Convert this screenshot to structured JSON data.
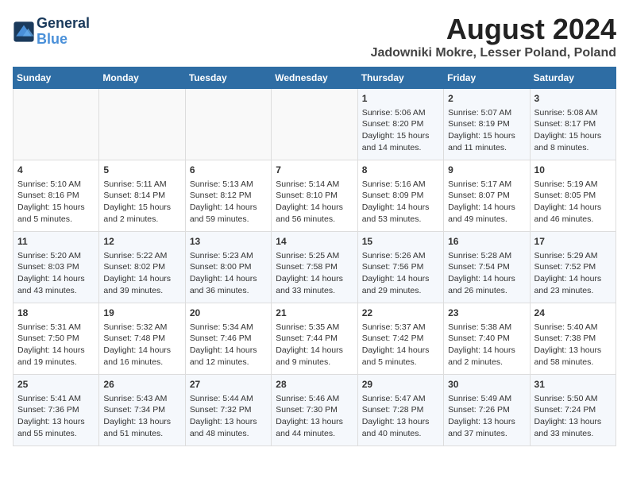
{
  "header": {
    "logo_line1": "General",
    "logo_line2": "Blue",
    "title": "August 2024",
    "subtitle": "Jadowniki Mokre, Lesser Poland, Poland"
  },
  "days_of_week": [
    "Sunday",
    "Monday",
    "Tuesday",
    "Wednesday",
    "Thursday",
    "Friday",
    "Saturday"
  ],
  "weeks": [
    [
      {
        "day": "",
        "content": ""
      },
      {
        "day": "",
        "content": ""
      },
      {
        "day": "",
        "content": ""
      },
      {
        "day": "",
        "content": ""
      },
      {
        "day": "1",
        "content": "Sunrise: 5:06 AM\nSunset: 8:20 PM\nDaylight: 15 hours\nand 14 minutes."
      },
      {
        "day": "2",
        "content": "Sunrise: 5:07 AM\nSunset: 8:19 PM\nDaylight: 15 hours\nand 11 minutes."
      },
      {
        "day": "3",
        "content": "Sunrise: 5:08 AM\nSunset: 8:17 PM\nDaylight: 15 hours\nand 8 minutes."
      }
    ],
    [
      {
        "day": "4",
        "content": "Sunrise: 5:10 AM\nSunset: 8:16 PM\nDaylight: 15 hours\nand 5 minutes."
      },
      {
        "day": "5",
        "content": "Sunrise: 5:11 AM\nSunset: 8:14 PM\nDaylight: 15 hours\nand 2 minutes."
      },
      {
        "day": "6",
        "content": "Sunrise: 5:13 AM\nSunset: 8:12 PM\nDaylight: 14 hours\nand 59 minutes."
      },
      {
        "day": "7",
        "content": "Sunrise: 5:14 AM\nSunset: 8:10 PM\nDaylight: 14 hours\nand 56 minutes."
      },
      {
        "day": "8",
        "content": "Sunrise: 5:16 AM\nSunset: 8:09 PM\nDaylight: 14 hours\nand 53 minutes."
      },
      {
        "day": "9",
        "content": "Sunrise: 5:17 AM\nSunset: 8:07 PM\nDaylight: 14 hours\nand 49 minutes."
      },
      {
        "day": "10",
        "content": "Sunrise: 5:19 AM\nSunset: 8:05 PM\nDaylight: 14 hours\nand 46 minutes."
      }
    ],
    [
      {
        "day": "11",
        "content": "Sunrise: 5:20 AM\nSunset: 8:03 PM\nDaylight: 14 hours\nand 43 minutes."
      },
      {
        "day": "12",
        "content": "Sunrise: 5:22 AM\nSunset: 8:02 PM\nDaylight: 14 hours\nand 39 minutes."
      },
      {
        "day": "13",
        "content": "Sunrise: 5:23 AM\nSunset: 8:00 PM\nDaylight: 14 hours\nand 36 minutes."
      },
      {
        "day": "14",
        "content": "Sunrise: 5:25 AM\nSunset: 7:58 PM\nDaylight: 14 hours\nand 33 minutes."
      },
      {
        "day": "15",
        "content": "Sunrise: 5:26 AM\nSunset: 7:56 PM\nDaylight: 14 hours\nand 29 minutes."
      },
      {
        "day": "16",
        "content": "Sunrise: 5:28 AM\nSunset: 7:54 PM\nDaylight: 14 hours\nand 26 minutes."
      },
      {
        "day": "17",
        "content": "Sunrise: 5:29 AM\nSunset: 7:52 PM\nDaylight: 14 hours\nand 23 minutes."
      }
    ],
    [
      {
        "day": "18",
        "content": "Sunrise: 5:31 AM\nSunset: 7:50 PM\nDaylight: 14 hours\nand 19 minutes."
      },
      {
        "day": "19",
        "content": "Sunrise: 5:32 AM\nSunset: 7:48 PM\nDaylight: 14 hours\nand 16 minutes."
      },
      {
        "day": "20",
        "content": "Sunrise: 5:34 AM\nSunset: 7:46 PM\nDaylight: 14 hours\nand 12 minutes."
      },
      {
        "day": "21",
        "content": "Sunrise: 5:35 AM\nSunset: 7:44 PM\nDaylight: 14 hours\nand 9 minutes."
      },
      {
        "day": "22",
        "content": "Sunrise: 5:37 AM\nSunset: 7:42 PM\nDaylight: 14 hours\nand 5 minutes."
      },
      {
        "day": "23",
        "content": "Sunrise: 5:38 AM\nSunset: 7:40 PM\nDaylight: 14 hours\nand 2 minutes."
      },
      {
        "day": "24",
        "content": "Sunrise: 5:40 AM\nSunset: 7:38 PM\nDaylight: 13 hours\nand 58 minutes."
      }
    ],
    [
      {
        "day": "25",
        "content": "Sunrise: 5:41 AM\nSunset: 7:36 PM\nDaylight: 13 hours\nand 55 minutes."
      },
      {
        "day": "26",
        "content": "Sunrise: 5:43 AM\nSunset: 7:34 PM\nDaylight: 13 hours\nand 51 minutes."
      },
      {
        "day": "27",
        "content": "Sunrise: 5:44 AM\nSunset: 7:32 PM\nDaylight: 13 hours\nand 48 minutes."
      },
      {
        "day": "28",
        "content": "Sunrise: 5:46 AM\nSunset: 7:30 PM\nDaylight: 13 hours\nand 44 minutes."
      },
      {
        "day": "29",
        "content": "Sunrise: 5:47 AM\nSunset: 7:28 PM\nDaylight: 13 hours\nand 40 minutes."
      },
      {
        "day": "30",
        "content": "Sunrise: 5:49 AM\nSunset: 7:26 PM\nDaylight: 13 hours\nand 37 minutes."
      },
      {
        "day": "31",
        "content": "Sunrise: 5:50 AM\nSunset: 7:24 PM\nDaylight: 13 hours\nand 33 minutes."
      }
    ]
  ]
}
